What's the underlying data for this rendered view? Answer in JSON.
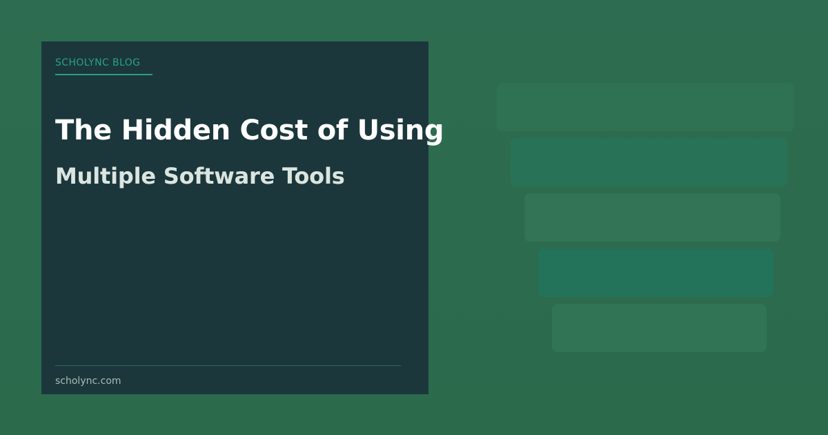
{
  "card": {
    "blog_label": "SCHOLYNC BLOG",
    "title_line1": "The Hidden Cost of Using",
    "title_line2": "Multiple Software Tools",
    "footer_url": "scholync.com"
  },
  "colors": {
    "background": "#2d6a4f",
    "card_background": "#1b373c",
    "accent": "#2aa184",
    "title": "#ffffff",
    "subtitle": "#dbe5df",
    "footer_text": "#a9bcb8"
  },
  "decorative_bars": {
    "count": 5,
    "colors": [
      "#2f7153",
      "#287257",
      "#327455",
      "#22735a",
      "#307455"
    ]
  }
}
